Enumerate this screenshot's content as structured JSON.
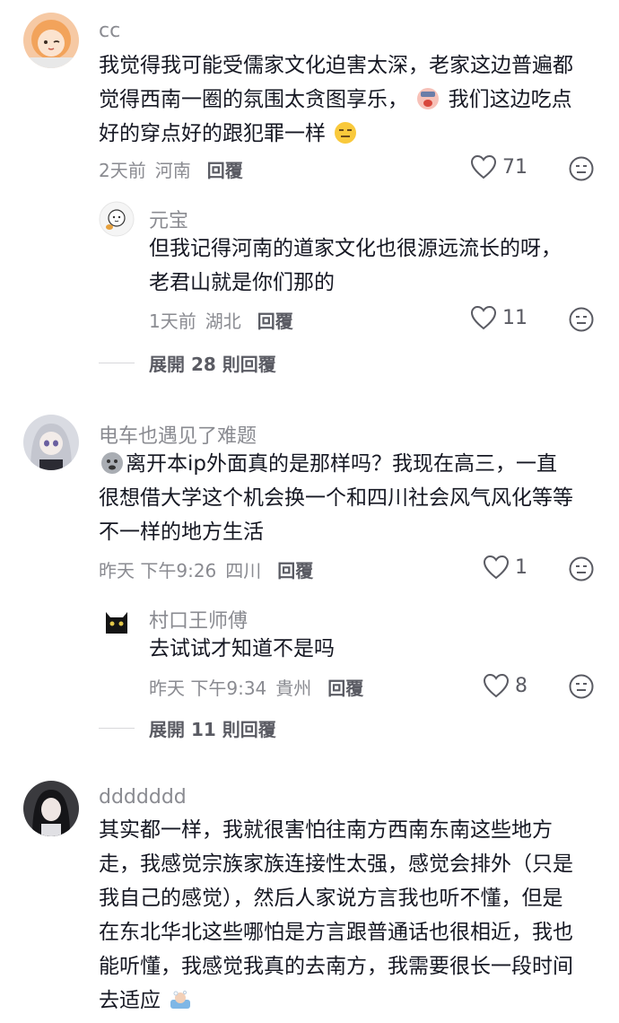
{
  "comments": [
    {
      "username": "cc",
      "text_lines": [
        "我觉得我可能受儒家文化迫害太深，老家这边普遍都",
        "觉得西南一圈的氛围太贪图享乐，",
        "好的穿点好的跟犯罪一样"
      ],
      "text_line2_suffix": "我们这边吃点",
      "time": "2天前",
      "location": "河南",
      "reply_label": "回覆",
      "likes": "71",
      "replies": [
        {
          "username": "元宝",
          "text_lines": [
            "但我记得河南的道家文化也很源远流长的呀，",
            "老君山就是你们那的"
          ],
          "time": "1天前",
          "location": "湖北",
          "reply_label": "回覆",
          "likes": "11"
        }
      ],
      "expand_label": "展開 28 則回覆"
    },
    {
      "username": "电车也遇见了难题",
      "text_lines": [
        "离开本ip外面真的是那样吗？我现在高三，一直",
        "很想借大学这个机会换一个和四川社会风气风化等等",
        "不一样的地方生活"
      ],
      "time": "昨天 下午9:26",
      "location": "四川",
      "reply_label": "回覆",
      "likes": "1",
      "replies": [
        {
          "username": "村口王师傅",
          "text_lines": [
            "去试试才知道不是吗"
          ],
          "time": "昨天 下午9:34",
          "location": "貴州",
          "reply_label": "回覆",
          "likes": "8"
        }
      ],
      "expand_label": "展開 11 則回覆"
    },
    {
      "username": "ddddddd",
      "text_lines": [
        "其实都一样，我就很害怕往南方西南东南这些地方",
        "走，我感觉宗族家族连接性太强，感觉会排外（只是",
        "我自己的感觉），然后人家说方言我也听不懂，但是",
        "在东北华北这些哪怕是方言跟普通话也很相近，我也",
        "能听懂，我感觉我真的去南方，我需要很长一段时间",
        "去适应"
      ]
    }
  ],
  "icons": {
    "like": "heart-outline-icon",
    "dislike": "neutral-face-icon"
  },
  "colors": {
    "text": "#161823",
    "meta": "#8a8b91",
    "action": "#5a5b63"
  }
}
